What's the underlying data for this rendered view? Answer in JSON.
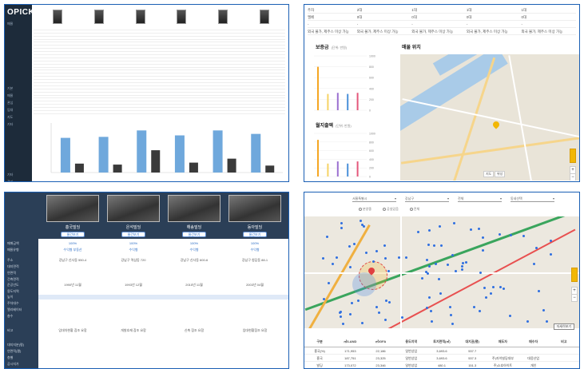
{
  "panel1": {
    "logo": "OPICK",
    "sidebar_items": [
      "매물",
      "",
      "",
      "",
      "",
      "",
      "",
      "",
      "",
      "기본",
      "매물",
      "관심",
      "임대",
      "지도",
      "기타",
      "",
      "",
      "",
      "",
      "",
      "",
      "기타",
      "관리",
      "설정",
      "문의",
      "공지"
    ],
    "table_rows": 28
  },
  "panel2": {
    "rows": [
      [
        "주차",
        "2대",
        "1대",
        "1대",
        "1대"
      ],
      [
        "엘베",
        "0대",
        "0대",
        "0대",
        "0대"
      ],
      [
        "-",
        "-",
        "-",
        "-",
        "-"
      ],
      [
        "외국 불가, 제주스 미상 가능",
        "외국 불가, 제주스 미상 가능",
        "외국 불가, 제주스 미상 가능",
        "외국 불가, 제주스 미상 가능",
        "외국 불가, 제주스 미상 가능"
      ]
    ],
    "chart_deposit_title": "보증금",
    "chart_deposit_unit": "(단위: 만원)",
    "chart_rent_title": "월지출액",
    "chart_rent_unit": "(단위: 만원)",
    "map_title": "매물 위치",
    "map_btn_map": "지도",
    "map_btn_sat": "위성"
  },
  "panel3": {
    "buildings": [
      "흥국빌딩",
      "은석빌딩",
      "해송빌딩",
      "동아빌딩"
    ],
    "compare_btn": "물건보기",
    "percent": [
      "100%",
      "100%",
      "100%",
      "100%"
    ],
    "links": [
      "수익형 부동산",
      "수익형",
      "수익형",
      "수익형"
    ],
    "row_labels": [
      "매매금액",
      "매물유형",
      "주소",
      "대지면적",
      "연면적",
      "건축면적",
      "준공년도",
      "용도지역",
      "높이",
      "주차대수",
      "엘리베이터",
      "층수",
      "비고",
      "",
      "",
      "",
      "대지지분(평)",
      "연면적(평)",
      "층별",
      "공시지가"
    ],
    "addr": [
      "강남구 신사동 550-4",
      "강남구 역삼동 720",
      "강남구 신사동 600-6",
      "강남구 청담동 88-1"
    ],
    "years": [
      "1990년 11월",
      "1993년 12월",
      "2015년 11월",
      "2003년 04월"
    ],
    "notes": [
      "임대차현황 참조 요함",
      "개발호재 참조 요함",
      "신축 참조 요함",
      "임대현황참조 요함"
    ]
  },
  "panel4": {
    "selects": [
      "서울특별시",
      "강남구",
      "전체",
      "동네선택"
    ],
    "radios": [
      "분양중",
      "공실있음",
      "전체"
    ],
    "detail_btn": "자세히보기",
    "table_headers": [
      "구분",
      "㎡/LAND",
      "㎡/GFA",
      "용도지역",
      "토지면적(㎡)",
      "대지권(평)",
      "매도자",
      "매수자",
      "비고"
    ],
    "table_rows": [
      [
        "흥국(%)",
        "171,953",
        "22,186",
        "일반상업",
        "3,693.6",
        "537.7",
        "",
        "",
        ""
      ],
      [
        "흥국",
        "187,751",
        "23,325",
        "일반상업",
        "3,693.6",
        "537.3",
        "주)자이빌딩대부",
        "대웅산업",
        ""
      ],
      [
        "빌딩",
        "173,072",
        "23,346",
        "일반상업",
        "480.1",
        "151.3",
        "주)소호아이트",
        "개인",
        ""
      ]
    ]
  },
  "chart_data": [
    {
      "type": "bar",
      "categories": [
        "1",
        "2",
        "3",
        "4",
        "5",
        "6"
      ],
      "series": [
        {
          "values": [
            70,
            72,
            85,
            75,
            85,
            78
          ]
        },
        {
          "values": [
            18,
            16,
            45,
            20,
            28,
            14
          ]
        }
      ],
      "ylim": [
        0,
        100
      ]
    },
    {
      "type": "bar",
      "categories": [
        "1",
        "2",
        "3",
        "4",
        "5"
      ],
      "values": [
        80,
        30,
        32,
        30,
        32
      ],
      "yticks": [
        "1000",
        "800",
        "600",
        "400",
        "200",
        "0"
      ]
    },
    {
      "type": "bar",
      "categories": [
        "1",
        "2",
        "3",
        "4",
        "5"
      ],
      "values": [
        85,
        30,
        35,
        30,
        35
      ],
      "yticks": [
        "1000",
        "800",
        "600",
        "400",
        "200",
        "0"
      ]
    }
  ],
  "colors": {
    "sidebar": "#1d2b3a",
    "accent": "#1a5fb4",
    "bar_blue": "#6fa8dc",
    "bar_dark": "#3a3a3a",
    "orange": "#f5a623",
    "map_bg": "#e9e4d8",
    "water": "#a9cbe8"
  }
}
